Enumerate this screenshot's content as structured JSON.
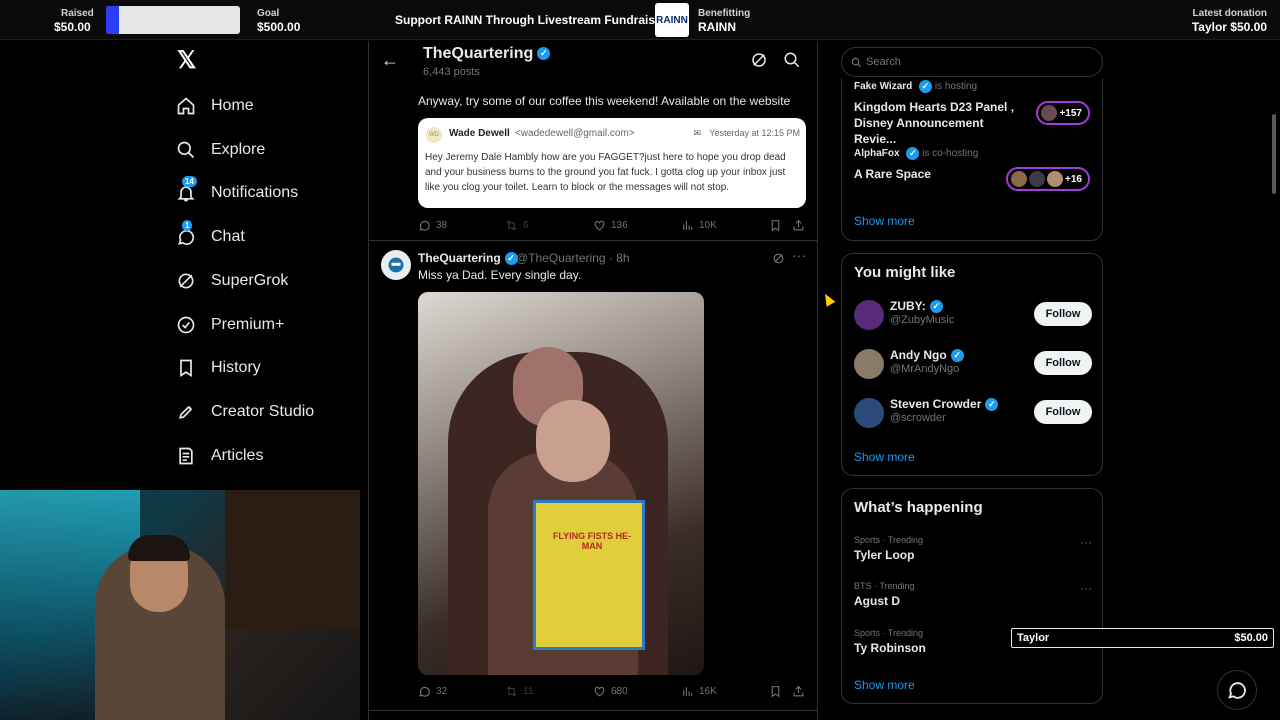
{
  "fundraiser": {
    "raised_label": "Raised",
    "raised_value": "$50.00",
    "progress_fraction": 0.1,
    "goal_label": "Goal",
    "goal_value": "$500.00",
    "title": "Support RAINN Through Livestream Fundraising",
    "logo_text": "RAINN",
    "benefitting_label": "Benefitting",
    "benefitting_value": "RAINN",
    "latest_label": "Latest donation",
    "latest_value": "Taylor $50.00"
  },
  "nav": {
    "logo": "𝕏",
    "items": [
      {
        "label": "Home",
        "icon": "home-icon"
      },
      {
        "label": "Explore",
        "icon": "search-icon"
      },
      {
        "label": "Notifications",
        "icon": "bell-icon",
        "badge": "14"
      },
      {
        "label": "Chat",
        "icon": "chat-icon",
        "badge": "1"
      },
      {
        "label": "SuperGrok",
        "icon": "grok-icon"
      },
      {
        "label": "Premium+",
        "icon": "premium-icon"
      },
      {
        "label": "History",
        "icon": "bookmark-icon"
      },
      {
        "label": "Creator Studio",
        "icon": "rocket-icon"
      },
      {
        "label": "Articles",
        "icon": "article-icon"
      }
    ]
  },
  "profile": {
    "name": "TheQuartering",
    "posts": "6,443 posts"
  },
  "tweet1": {
    "text": "Anyway, try some of our coffee this weekend!  Available on the website",
    "email": {
      "avatar": "WD",
      "from": "Wade Dewell",
      "address": "<wadedewell@gmail.com>",
      "time": "Yesterday at 12:15 PM",
      "body": "Hey Jeremy Dale Hambly how are you FAGGET?just here to hope you drop dead and your business burns to the ground you fat fuck. I gotta clog up your inbox just like you clog your toilet. Learn to block or the messages will not stop."
    },
    "replies": "38",
    "reposts": "6",
    "likes": "136",
    "views": "10K"
  },
  "tweet2": {
    "name": "TheQuartering",
    "handle": "@TheQuartering · 8h",
    "text": "Miss ya Dad. Every single day.",
    "box_text": "FLYING FISTS HE-MAN",
    "replies": "32",
    "reposts": "11",
    "likes": "680",
    "views": "16K"
  },
  "search": {
    "placeholder": "Search"
  },
  "spaces": {
    "s1_host": "Fake Wizard",
    "s1_role": "is hosting",
    "s1_title": "Kingdom Hearts D23 Panel , Disney Announcement Revie...",
    "s1_count": "+157",
    "s2_host": "AlphaFox",
    "s2_role": "is co-hosting",
    "s2_title": "A Rare Space",
    "s2_count": "+16",
    "show_more": "Show more"
  },
  "might_like": {
    "title": "You might like",
    "people": [
      {
        "name": "ZUBY:",
        "handle": "@ZubyMusic",
        "button": "Follow"
      },
      {
        "name": "Andy Ngo",
        "handle": "@MrAndyNgo",
        "button": "Follow"
      },
      {
        "name": "Steven Crowder",
        "handle": "@scrowder",
        "button": "Follow"
      }
    ],
    "show_more": "Show more"
  },
  "happening": {
    "title": "What’s happening",
    "trends": [
      {
        "category": "Sports · Trending",
        "title": "Tyler Loop"
      },
      {
        "category": "BTS · Trending",
        "title": "Agust D"
      },
      {
        "category": "Sports · Trending",
        "title": "Ty Robinson"
      }
    ],
    "show_more": "Show more"
  },
  "donation_overlay": {
    "name": "Taylor",
    "amount": "$50.00"
  },
  "colors": {
    "accent": "#1d9bf0",
    "progress": "#2a3cf5",
    "space_ring": "#a33be0"
  }
}
